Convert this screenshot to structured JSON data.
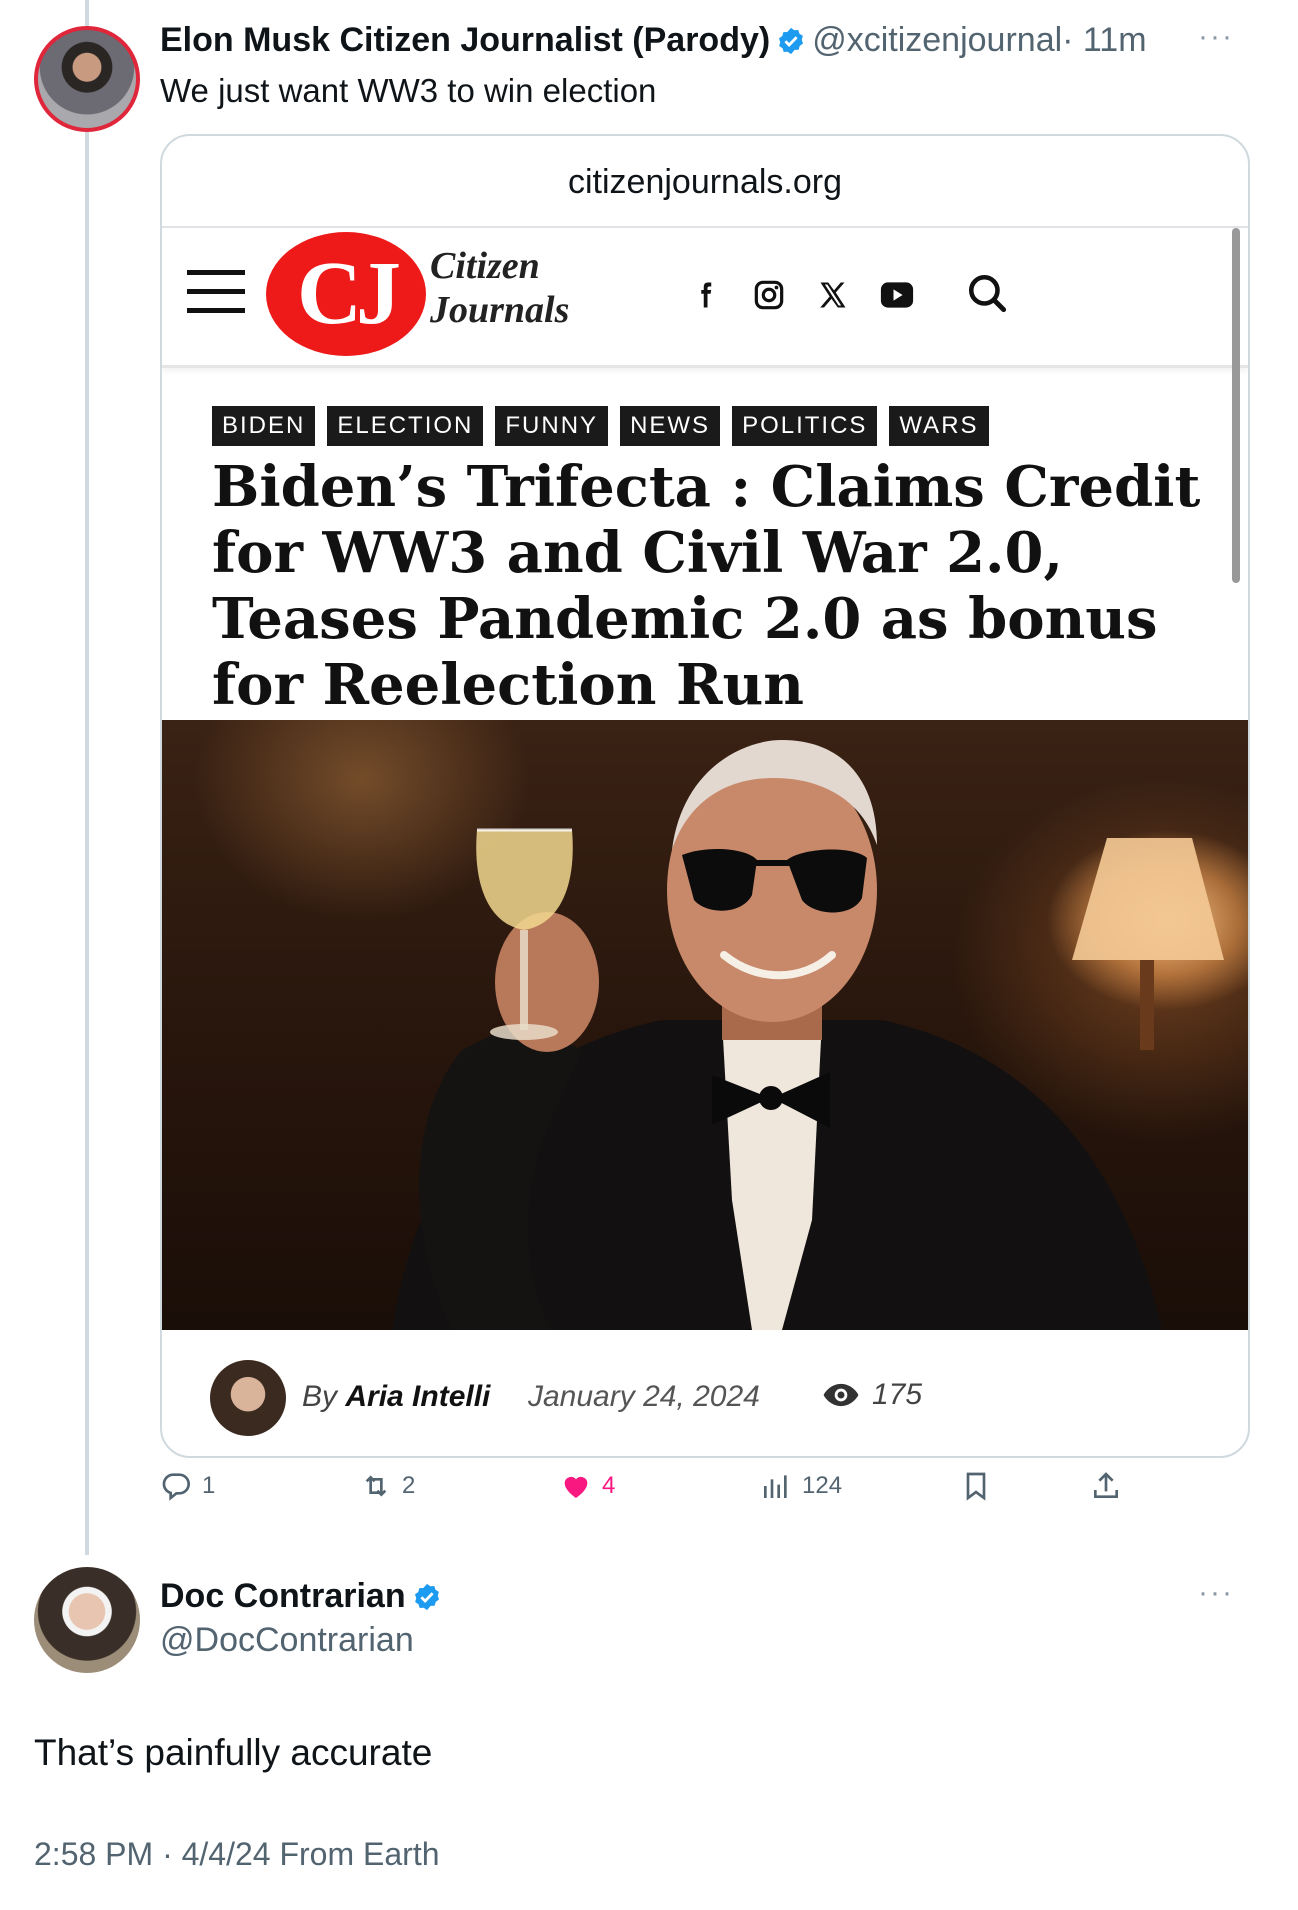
{
  "colors": {
    "verified": "#1d9bf0",
    "like": "#f91880",
    "muted": "#536471",
    "cj_red": "#ee1a1a"
  },
  "tweet": {
    "author_name": "Elon Musk Citizen Journalist (Parody)",
    "handle": "@xcitizenjournal",
    "time": "· 11m",
    "more": "···",
    "text": "We just want WW3 to win election"
  },
  "card": {
    "domain": "citizenjournals.org",
    "logo_initials": "CJ",
    "logo_word_line1": "Citizen",
    "logo_word_line2": "Journals",
    "social_icons": [
      "facebook-icon",
      "instagram-icon",
      "x-icon",
      "youtube-icon"
    ],
    "tags": [
      "BIDEN",
      "ELECTION",
      "FUNNY",
      "NEWS",
      "POLITICS",
      "WARS"
    ],
    "headline": "Biden’s Trifecta : Claims Credit for WW3 and Civil War 2.0, Teases Pandemic 2.0 as bonus for Reelection Run",
    "by_prefix": "By",
    "author": "Aria Intelli",
    "date": "January 24, 2024",
    "views": "175"
  },
  "actions": {
    "replies": "1",
    "reposts": "2",
    "likes": "4",
    "views": "124"
  },
  "reply": {
    "author_name": "Doc Contrarian",
    "handle": "@DocContrarian",
    "more": "···",
    "text": "That’s painfully accurate",
    "meta": "2:58 PM · 4/4/24 From Earth"
  }
}
